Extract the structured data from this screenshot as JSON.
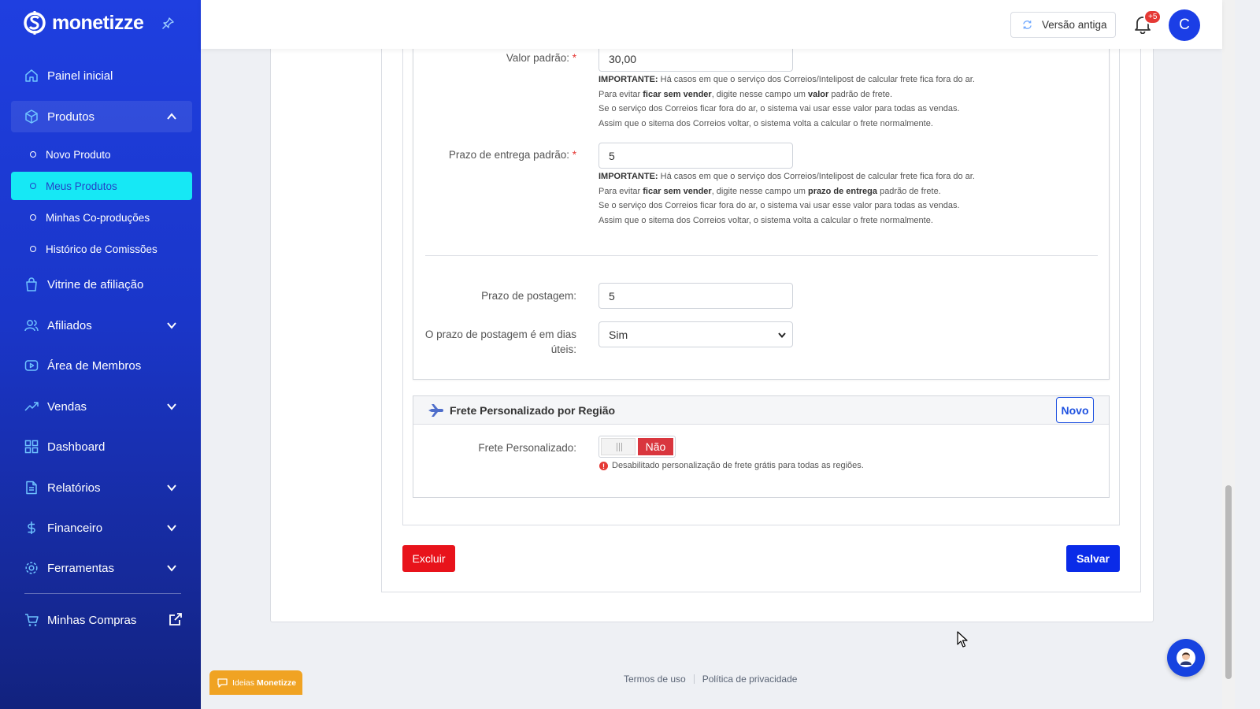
{
  "app": {
    "brand": "monetizze"
  },
  "sidebar": {
    "items": [
      {
        "label": "Painel inicial"
      },
      {
        "label": "Produtos"
      },
      {
        "label": "Vitrine de afiliação"
      },
      {
        "label": "Afiliados"
      },
      {
        "label": "Área de Membros"
      },
      {
        "label": "Vendas"
      },
      {
        "label": "Dashboard"
      },
      {
        "label": "Relatórios"
      },
      {
        "label": "Financeiro"
      },
      {
        "label": "Ferramentas"
      },
      {
        "label": "Minhas Compras"
      }
    ],
    "subitems": [
      {
        "label": "Novo Produto"
      },
      {
        "label": "Meus Produtos"
      },
      {
        "label": "Minhas Co-produções"
      },
      {
        "label": "Histórico de Comissões"
      }
    ]
  },
  "topbar": {
    "old_version_label": "Versão antiga",
    "notification_count": "+5",
    "avatar_initial": "C"
  },
  "form": {
    "valor_padrao": {
      "label": "Valor padrão:",
      "required_mark": "*",
      "value": "30,00",
      "help": {
        "line1_bold": "IMPORTANTE:",
        "line1_text": " Há casos em que o serviço dos Correios/Intelipost de calcular frete fica fora do ar.",
        "line2_pre": "Para evitar ",
        "line2_bold": "ficar sem vender",
        "line2_mid": ", digite nesse campo um ",
        "line2_bold2": "valor",
        "line2_post": " padrão de frete.",
        "line3": "Se o serviço dos Correios ficar fora do ar, o sistema vai usar esse valor para todas as vendas.",
        "line4": "Assim que o sitema dos Correios voltar, o sistema volta a calcular o frete normalmente."
      }
    },
    "prazo_entrega": {
      "label": "Prazo de entrega padrão:",
      "required_mark": "*",
      "value": "5",
      "help": {
        "line1_bold": "IMPORTANTE:",
        "line1_text": " Há casos em que o serviço dos Correios/Intelipost de calcular frete fica fora do ar.",
        "line2_pre": "Para evitar ",
        "line2_bold": "ficar sem vender",
        "line2_mid": ", digite nesse campo um ",
        "line2_bold2": "prazo de entrega",
        "line2_post": " padrão de frete.",
        "line3": "Se o serviço dos Correios ficar fora do ar, o sistema vai usar esse valor para todas as vendas.",
        "line4": "Assim que o sitema dos Correios voltar, o sistema volta a calcular o frete normalmente."
      }
    },
    "prazo_postagem": {
      "label": "Prazo de postagem:",
      "value": "5"
    },
    "dias_uteis": {
      "label_line1": "O prazo de postagem é em dias",
      "label_line2": "úteis:",
      "selected": "Sim"
    }
  },
  "frete": {
    "title": "Frete Personalizado por Região",
    "new_button": "Novo",
    "toggle_label": "Frete Personalizado:",
    "toggle_state": "Não",
    "error_icon": "!",
    "error_text": "Desabilitado personalização de frete grátis para todas as regiões."
  },
  "actions": {
    "delete_label": "Excluir",
    "save_label": "Salvar"
  },
  "footer": {
    "terms": "Termos de uso",
    "privacy": "Política de privacidade",
    "ideas_prefix": "Ideias",
    "ideas_brand": "Monetizze"
  },
  "colors": {
    "sidebar_bg": "#1f3fe0",
    "selected_sub": "#16e8f5",
    "primary": "#0a2be8",
    "danger": "#e8131b",
    "toggle_off": "#d9363e",
    "ideas": "#f0a323"
  }
}
